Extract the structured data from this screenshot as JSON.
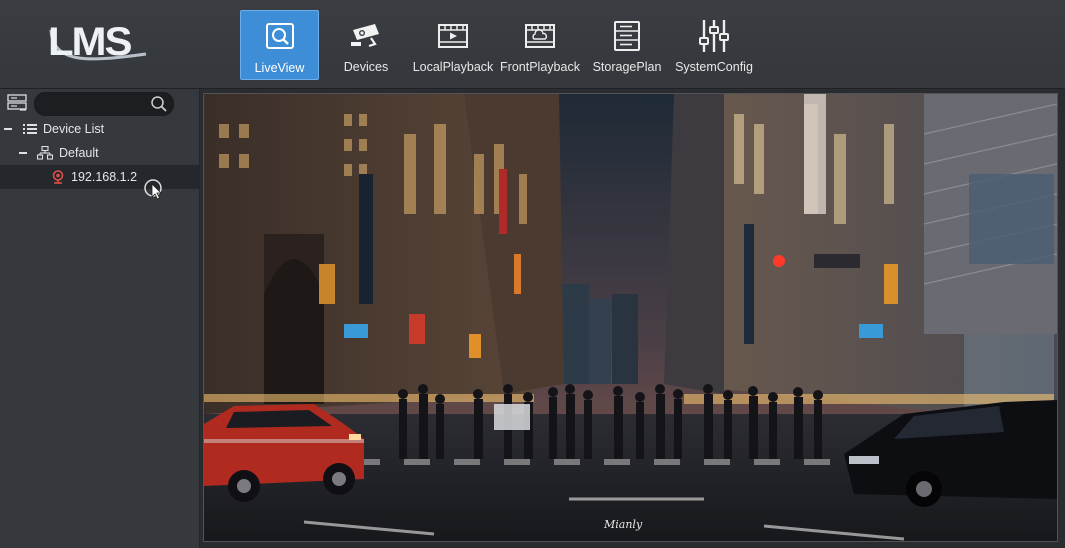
{
  "app": {
    "logo_text": "LMS"
  },
  "nav": {
    "items": [
      {
        "label": "LiveView",
        "icon": "liveview-icon",
        "active": true
      },
      {
        "label": "Devices",
        "icon": "camera-icon",
        "active": false
      },
      {
        "label": "LocalPlayback",
        "icon": "local-playback-icon",
        "active": false
      },
      {
        "label": "FrontPlayback",
        "icon": "front-playback-icon",
        "active": false
      },
      {
        "label": "StoragePlan",
        "icon": "storage-icon",
        "active": false
      },
      {
        "label": "SystemConfig",
        "icon": "sliders-icon",
        "active": false
      }
    ]
  },
  "sidebar": {
    "search": {
      "value": "",
      "placeholder": ""
    },
    "tree": {
      "root_label": "Device List",
      "group_label": "Default",
      "device_label": "192.168.1.2"
    }
  },
  "video": {
    "watermark": "Mianly"
  },
  "colors": {
    "active_tab": "#3d8ed6",
    "topbar": "#36393e",
    "sidebar": "#35383d",
    "device_icon": "#e0504a"
  }
}
